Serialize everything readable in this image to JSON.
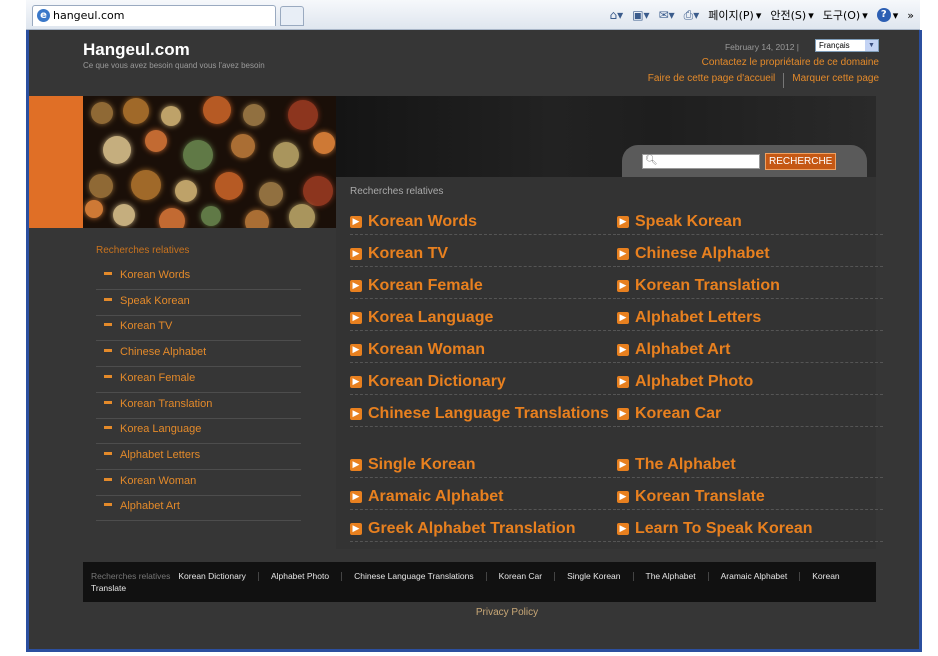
{
  "browser": {
    "tab_title": "hangeul.com",
    "menu_page": "페이지(P)",
    "menu_safety": "안전(S)",
    "menu_tools": "도구(O)",
    "overflow": "»",
    "ie_glyph": "e"
  },
  "header": {
    "title": "Hangeul.com",
    "tagline": "Ce que vous avez besoin quand vous l'avez besoin",
    "date": "February 14, 2012 |",
    "language": "Français",
    "contact": "Contactez le propriétaire de ce domaine",
    "homepage_link": "Faire de cette page d'accueil",
    "bookmark_link": "Marquer cette page"
  },
  "search": {
    "button_label": "RECHERCHE",
    "value": ""
  },
  "main": {
    "heading": "Recherches relatives",
    "results_left": [
      "Korean Words",
      "Korean TV",
      "Korean Female",
      "Korea Language",
      "Korean Woman",
      "Korean Dictionary",
      "Chinese Language Translations",
      "Single Korean",
      "Aramaic Alphabet",
      "Greek Alphabet Translation"
    ],
    "results_right": [
      "Speak Korean",
      "Chinese Alphabet",
      "Korean Translation",
      "Alphabet Letters",
      "Alphabet Art",
      "Alphabet Photo",
      "Korean Car",
      "The Alphabet",
      "Korean Translate",
      "Learn To Speak Korean"
    ]
  },
  "sidebar": {
    "heading": "Recherches relatives",
    "items": [
      "Korean Words",
      "Speak Korean",
      "Korean TV",
      "Chinese Alphabet",
      "Korean Female",
      "Korean Translation",
      "Korea Language",
      "Alphabet Letters",
      "Korean Woman",
      "Alphabet Art"
    ]
  },
  "footer": {
    "heading": "Recherches relatives",
    "links": [
      "Korean Dictionary",
      "Alphabet Photo",
      "Chinese Language Translations",
      "Korean Car",
      "Single Korean",
      "The Alphabet",
      "Aramaic Alphabet",
      "Korean Translate"
    ],
    "privacy": "Privacy Policy"
  },
  "colors": {
    "accent": "#e8801f",
    "background": "#363636",
    "footer_bg": "#111111",
    "banner_orange": "#e06f26"
  }
}
